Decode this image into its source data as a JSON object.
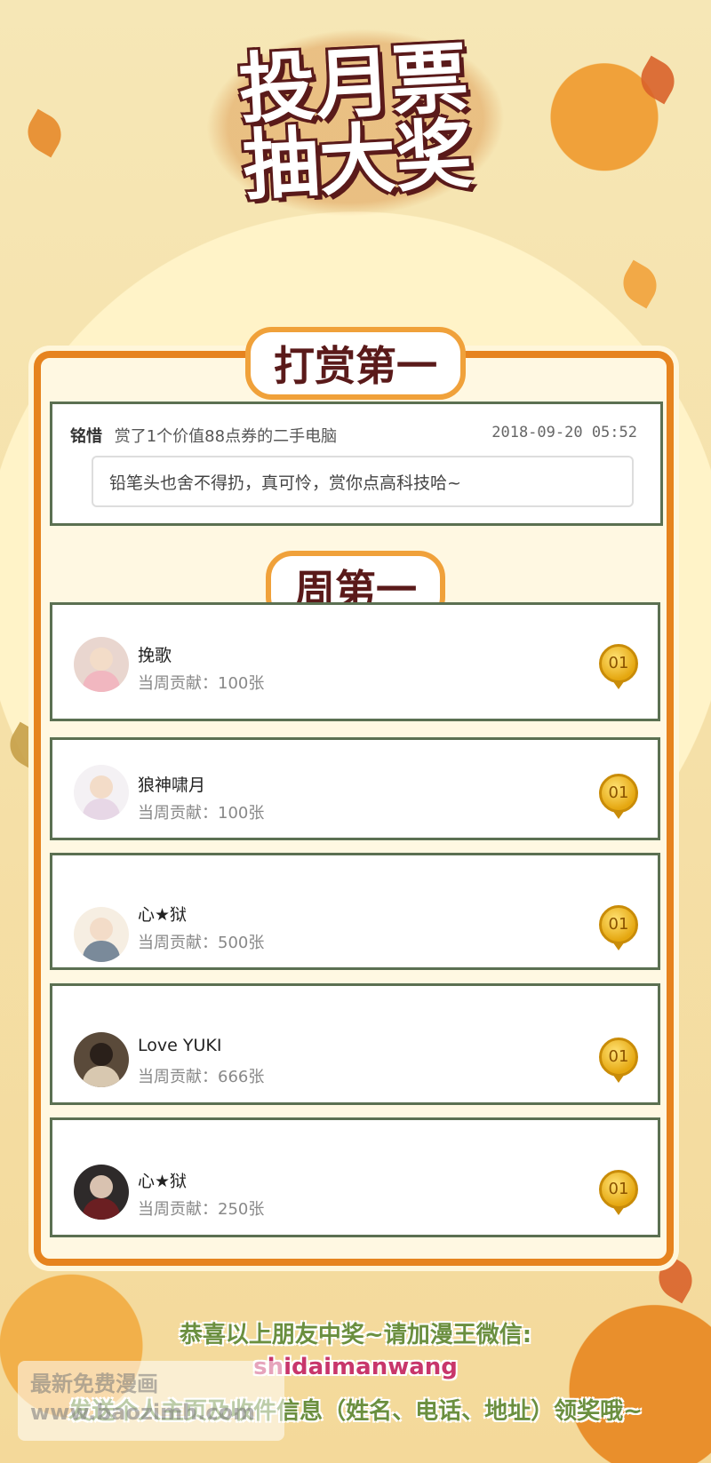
{
  "title": {
    "line1": "投月票",
    "line2": "抽大奖"
  },
  "tip_section": {
    "heading": "打赏第一",
    "user": "铭惜",
    "action": "赏了1个价值88点券的二手电脑",
    "date": "2018-09-20 05:52",
    "message": "铅笔头也舍不得扔，真可怜，赏你点高科技哈~"
  },
  "weekly_section": {
    "heading": "周第一",
    "entries": [
      {
        "name": "挽歌",
        "contribution": "当周贡献：100张",
        "rank": "01"
      },
      {
        "name": "狼神啸月",
        "contribution": "当周贡献：100张",
        "rank": "01"
      },
      {
        "name": "心★狱",
        "contribution": "当周贡献：500张",
        "rank": "01"
      },
      {
        "name": "Love YUKI",
        "contribution": "当周贡献：666张",
        "rank": "01"
      },
      {
        "name": "心★狱",
        "contribution": "当周贡献：250张",
        "rank": "01"
      }
    ]
  },
  "footer": {
    "line1": "恭喜以上朋友中奖~请加漫王微信:",
    "wechat": "shidaimanwang",
    "line3": "发送个人主页及收件信息（姓名、电话、地址）领奖哦~"
  },
  "watermark": {
    "line1": "最新免费漫画",
    "line2": "www.baozimh.com"
  },
  "colors": {
    "frame": "#e6831e",
    "card_border": "#5b7052",
    "footer_green": "#6b8f3f",
    "wechat_pink": "#c8366b"
  }
}
